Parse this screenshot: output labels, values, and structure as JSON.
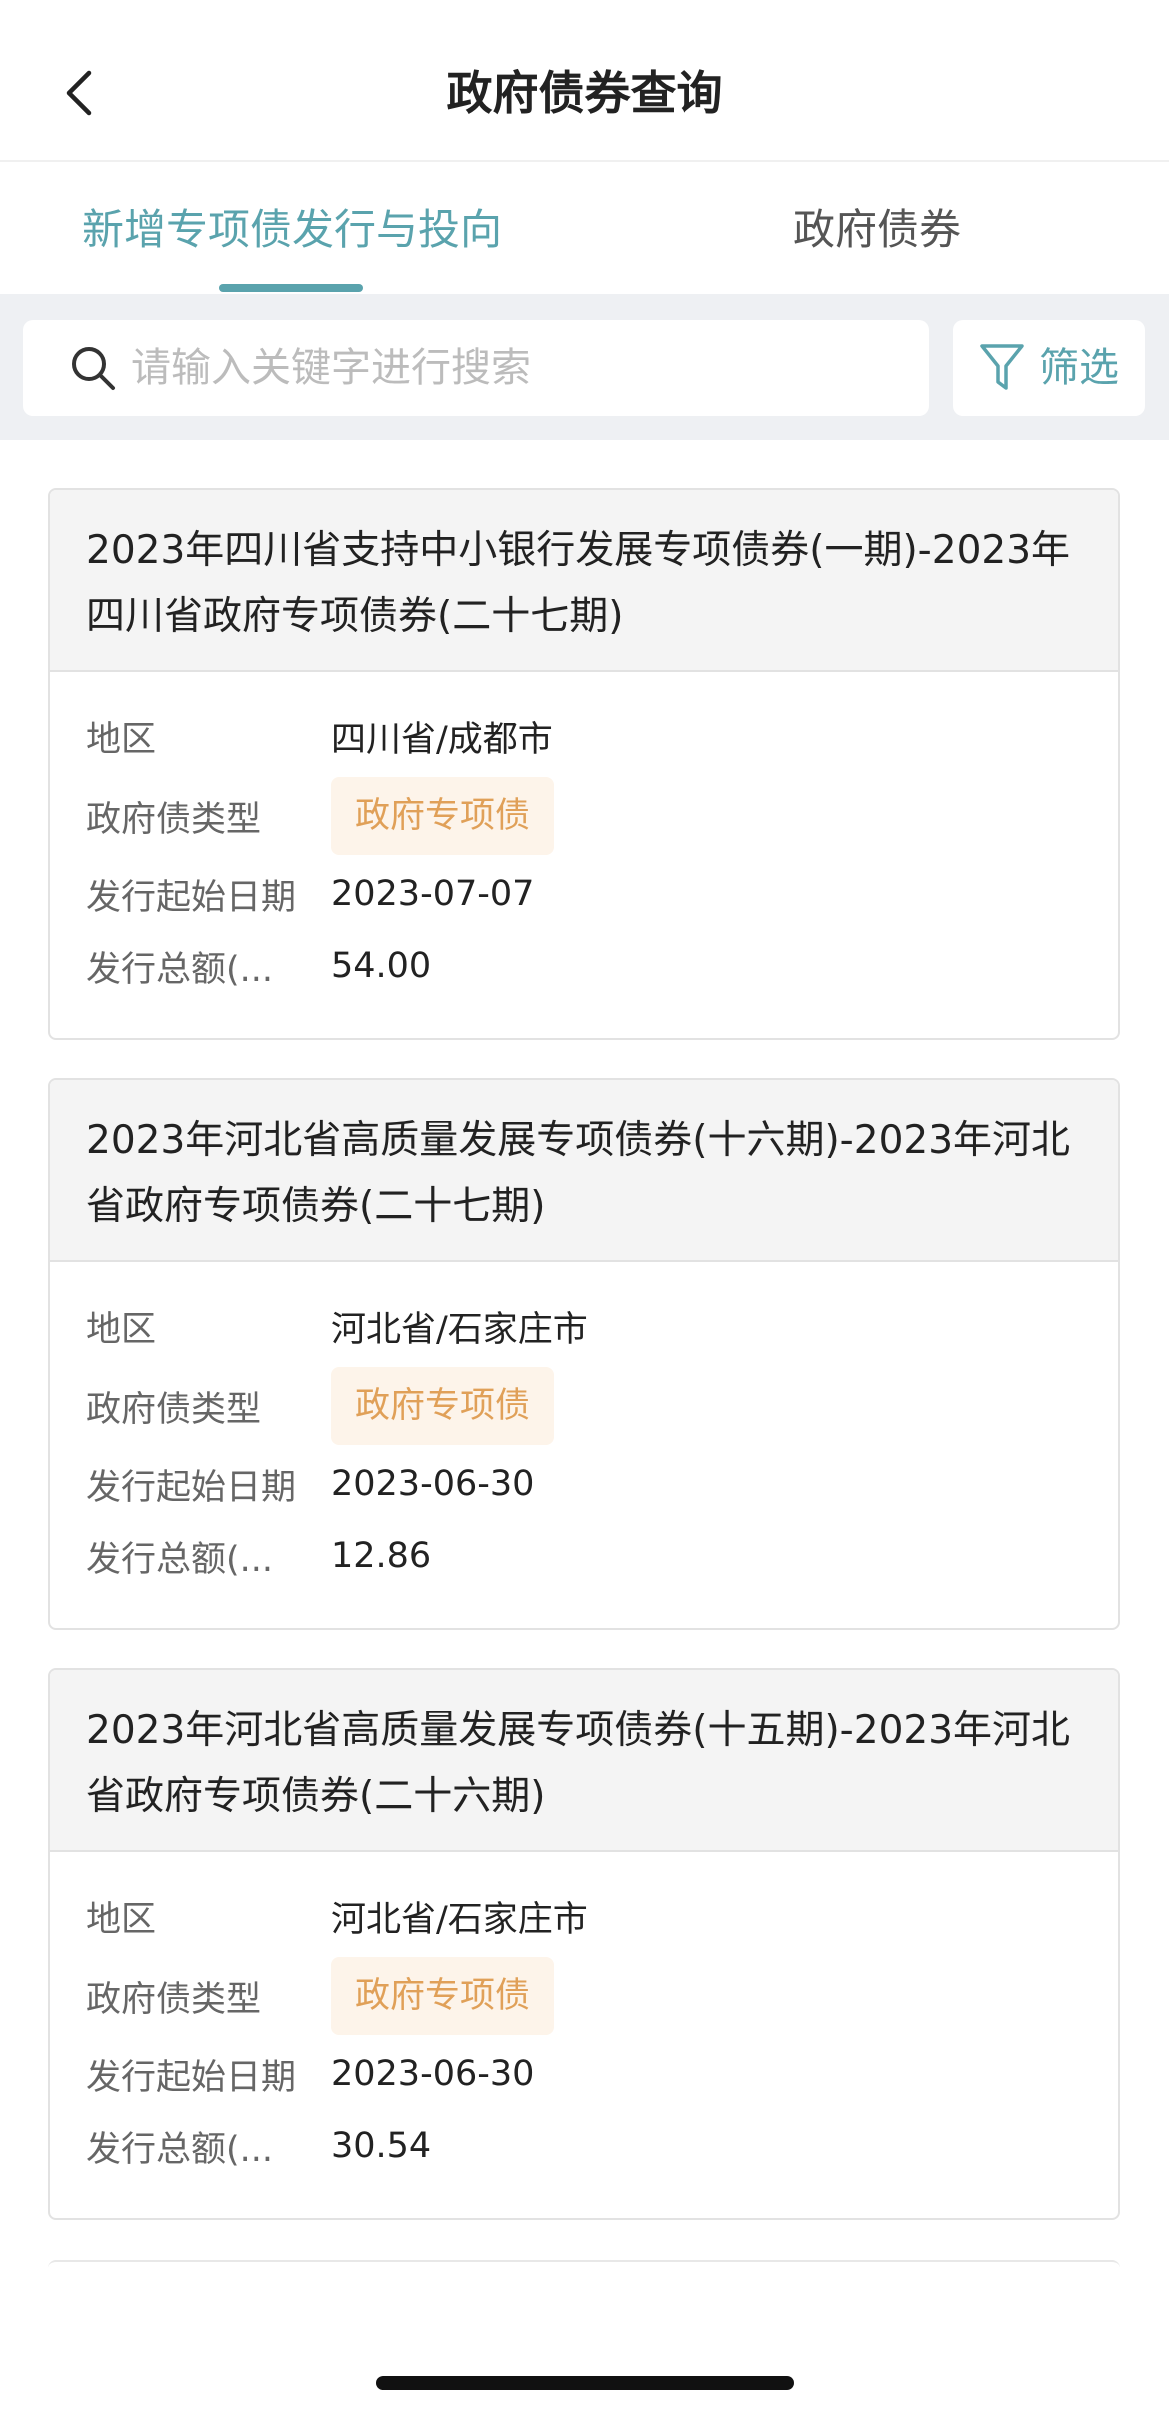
{
  "header": {
    "title": "政府债券查询",
    "back_icon": "chevron-left-icon"
  },
  "tabs": [
    {
      "label": "新增专项债发行与投向",
      "active": true
    },
    {
      "label": "政府债券",
      "active": false
    }
  ],
  "search": {
    "placeholder": "请输入关键字进行搜索",
    "value": ""
  },
  "filter": {
    "label": "筛选",
    "icon": "funnel-icon"
  },
  "colors": {
    "accent": "#5aa3ad",
    "tag_bg": "#fdf4ea",
    "tag_text": "#e0a058"
  },
  "field_labels": {
    "region": "地区",
    "bond_type": "政府债类型",
    "issue_date": "发行起始日期",
    "amount": "发行总额(..."
  },
  "bonds": [
    {
      "title": "2023年四川省支持中小银行发展专项债券(一期)-2023年四川省政府专项债券(二十七期)",
      "region": "四川省/成都市",
      "bond_type": "政府专项债",
      "issue_date": "2023-07-07",
      "amount": "54.00"
    },
    {
      "title": "2023年河北省高质量发展专项债券(十六期)-2023年河北省政府专项债券(二十七期)",
      "region": "河北省/石家庄市",
      "bond_type": "政府专项债",
      "issue_date": "2023-06-30",
      "amount": "12.86"
    },
    {
      "title": "2023年河北省高质量发展专项债券(十五期)-2023年河北省政府专项债券(二十六期)",
      "region": "河北省/石家庄市",
      "bond_type": "政府专项债",
      "issue_date": "2023-06-30",
      "amount": "30.54"
    }
  ]
}
